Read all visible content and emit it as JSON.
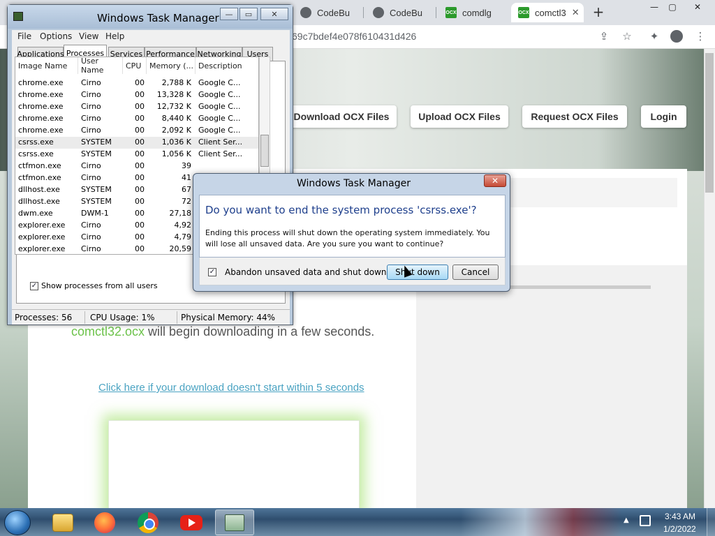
{
  "browser": {
    "tabs": [
      {
        "label": "CodeBu",
        "favicon": "globe-icon"
      },
      {
        "label": "CodeBu",
        "favicon": "globe-icon"
      },
      {
        "label": "comdlg",
        "favicon": "ocx-icon"
      },
      {
        "label": "comctl3",
        "favicon": "ocx-icon",
        "active": true
      }
    ],
    "new_tab": "+",
    "window_controls": {
      "minimize": "—",
      "maximize": "▢",
      "close": "✕"
    },
    "url_fragment": "69c7bdef4e078f610431d426"
  },
  "page": {
    "nav": [
      "Download OCX Files",
      "Upload OCX Files",
      "Request OCX Files",
      "Login"
    ],
    "download_filename": "comctl32.ocx",
    "download_message": " will begin downloading in a few seconds.",
    "download_link": "Click here if your download doesn't start within 5 seconds",
    "accent_color": "#6cc24a",
    "link_color": "#4aa3c2"
  },
  "taskmgr": {
    "title": "Windows Task Manager",
    "window_controls": {
      "minimize": "—",
      "maximize": "▭",
      "close": "✕"
    },
    "menu": [
      "File",
      "Options",
      "View",
      "Help"
    ],
    "tabs": [
      "Applications",
      "Processes",
      "Services",
      "Performance",
      "Networking",
      "Users"
    ],
    "active_tab": "Processes",
    "columns": [
      "Image Name",
      "User Name",
      "CPU",
      "Memory (...",
      "Description"
    ],
    "processes": [
      {
        "name": "chrome.exe",
        "user": "Cirno",
        "cpu": "00",
        "mem": "2,788 K",
        "desc": "Google C..."
      },
      {
        "name": "chrome.exe",
        "user": "Cirno",
        "cpu": "00",
        "mem": "13,328 K",
        "desc": "Google C..."
      },
      {
        "name": "chrome.exe",
        "user": "Cirno",
        "cpu": "00",
        "mem": "12,732 K",
        "desc": "Google C..."
      },
      {
        "name": "chrome.exe",
        "user": "Cirno",
        "cpu": "00",
        "mem": "8,440 K",
        "desc": "Google C..."
      },
      {
        "name": "chrome.exe",
        "user": "Cirno",
        "cpu": "00",
        "mem": "2,092 K",
        "desc": "Google C..."
      },
      {
        "name": "csrss.exe",
        "user": "SYSTEM",
        "cpu": "00",
        "mem": "1,036 K",
        "desc": "Client Ser...",
        "selected": true
      },
      {
        "name": "csrss.exe",
        "user": "SYSTEM",
        "cpu": "00",
        "mem": "1,056 K",
        "desc": "Client Ser..."
      },
      {
        "name": "ctfmon.exe",
        "user": "Cirno",
        "cpu": "00",
        "mem": "39",
        "desc": ""
      },
      {
        "name": "ctfmon.exe",
        "user": "Cirno",
        "cpu": "00",
        "mem": "41",
        "desc": ""
      },
      {
        "name": "dllhost.exe",
        "user": "SYSTEM",
        "cpu": "00",
        "mem": "67",
        "desc": ""
      },
      {
        "name": "dllhost.exe",
        "user": "SYSTEM",
        "cpu": "00",
        "mem": "72",
        "desc": ""
      },
      {
        "name": "dwm.exe",
        "user": "DWM-1",
        "cpu": "00",
        "mem": "27,18",
        "desc": ""
      },
      {
        "name": "explorer.exe",
        "user": "Cirno",
        "cpu": "00",
        "mem": "4,92",
        "desc": ""
      },
      {
        "name": "explorer.exe",
        "user": "Cirno",
        "cpu": "00",
        "mem": "4,79",
        "desc": ""
      },
      {
        "name": "explorer.exe",
        "user": "Cirno",
        "cpu": "00",
        "mem": "20,59",
        "desc": ""
      }
    ],
    "show_all_label": "Show processes from all users",
    "show_all_checked": "✓",
    "status": {
      "processes": "Processes: 56",
      "cpu": "CPU Usage: 1%",
      "memory": "Physical Memory: 44%"
    }
  },
  "dialog": {
    "title": "Windows Task Manager",
    "close": "✕",
    "question": "Do you want to end the system process 'csrss.exe'?",
    "message": "Ending this process will shut down the operating system immediately.  You will lose all unsaved data.  Are you sure you want to continue?",
    "checkbox_label": "Abandon unsaved data and shut down.",
    "checkbox_mark": "✓",
    "confirm": "Shut down",
    "cancel": "Cancel"
  },
  "taskbar": {
    "time": "3:43 AM",
    "date": "1/2/2022",
    "apps": [
      "windows-explorer",
      "firefox",
      "chrome",
      "youtube",
      "task-manager"
    ]
  }
}
